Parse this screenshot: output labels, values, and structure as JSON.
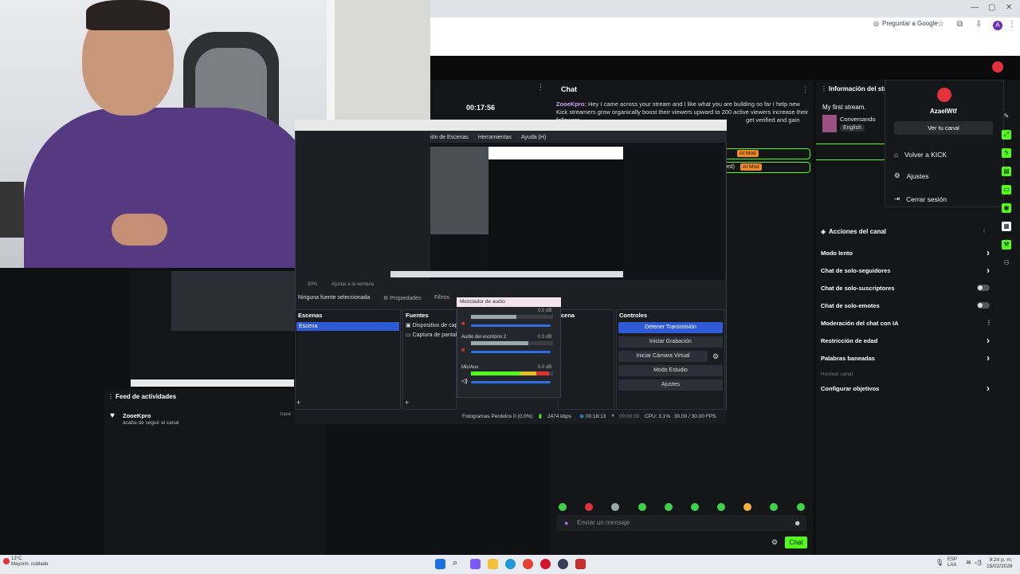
{
  "browser": {
    "google_button": "Preguntar a Google",
    "profile_initial": "A"
  },
  "stream": {
    "uptime": "00:17:56"
  },
  "chat": {
    "title": "Chat",
    "message_user": "ZooeKpro:",
    "message_text": "Hey I came across your stream and I like what you are building so far I help new Kick streamers grow organically boost their viewers upward to 200 active viewers increase their followers",
    "message_tail": "get verified and gain",
    "mod_tag_1": "d)",
    "mod_badge_1": "AI Mod",
    "mod_tag_2": "ated)",
    "mod_badge_2": "AI Mod",
    "input_placeholder": "Enviar un mensaje",
    "send_button": "Chat"
  },
  "stream_info": {
    "title": "Información del strea",
    "stream_title": "My first stream.",
    "category": "Conversando",
    "language": "English"
  },
  "account_menu": {
    "username": "AzaelWtf",
    "view_channel": "Ver tu canal",
    "items": [
      "Volver a KICK",
      "Ajustes",
      "Cerrar sesión"
    ]
  },
  "channel_actions": {
    "title": "Acciones del canal",
    "items": [
      {
        "label": "Modo lento",
        "control": "chevron"
      },
      {
        "label": "Chat de solo-seguidores",
        "control": "chevron"
      },
      {
        "label": "Chat de solo-suscriptores",
        "control": "toggle"
      },
      {
        "label": "Chat de solo-emotes",
        "control": "toggle"
      },
      {
        "label": "Moderación del chat con IA",
        "control": "graph"
      },
      {
        "label": "Restricción de edad",
        "control": "chevron"
      },
      {
        "label": "Palabras baneadas",
        "control": "chevron"
      },
      {
        "label": "Hostear canal",
        "control": "none"
      },
      {
        "label": "Configurar objetivos",
        "control": "chevron"
      }
    ]
  },
  "feed": {
    "title": "Feed de actividades",
    "user": "ZooeKpro",
    "action": "acaba de seguir al canal",
    "time": "hace"
  },
  "obs": {
    "menu": [
      "ión de Escenas",
      "Herramientas",
      "Ayuda (H)"
    ],
    "zoom": "30%",
    "fit": "Ajustar a la ventana",
    "no_source": "Ninguna fuente seleccionada",
    "properties": "Propiedades",
    "filters": "Filtros",
    "scenes_title": "Escenas",
    "scene_item": "Escena",
    "sources_title": "Fuentes",
    "sources": [
      "Dispositivo de cap",
      "Captura de pantal"
    ],
    "transitions_title": "cena",
    "controls_title": "Controles",
    "controls": [
      "Detener Transmisión",
      "Iniciar Grabación",
      "Iniciar Cámara Virtual",
      "Modo Estudio",
      "Ajustes"
    ],
    "mixer_title": "Mezclador de audio",
    "mixer_channels": [
      {
        "name": "",
        "db": "0.0 dB"
      },
      {
        "name": "Audio del escritorio 2",
        "db": "0.0 dB"
      },
      {
        "name": "Mic/Aux",
        "db": "0.0 dB"
      }
    ],
    "status": {
      "dropped": "Fotogramas Perdidos 0 (0,0%)",
      "bitrate": "2474 kbps",
      "live_time": "00:18:13",
      "rec_time": "00:00:00",
      "cpu": "CPU: 3.1%",
      "fps": "30.00 / 30.00 FPS"
    }
  },
  "taskbar": {
    "temperature": "13°C",
    "weather": "Mayorm. nublado",
    "lang_1": "ESP",
    "lang_2": "LAA",
    "time": "9:24 p. m.",
    "date": "15/02/2026"
  },
  "colors": {
    "kick_green": "#53fc18",
    "obs_blue": "#2f5bd6",
    "panel_bg": "#141517"
  }
}
